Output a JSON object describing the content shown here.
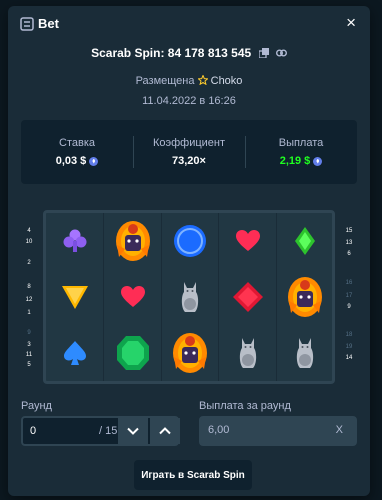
{
  "modal": {
    "title": "Bet",
    "close_label": "×"
  },
  "bet": {
    "title": "Scarab Spin: 84 178 813 545",
    "placed_prefix": "Размещена",
    "user": "Choko",
    "date": "11.04.2022 в 16:26"
  },
  "stats": {
    "wager_label": "Ставка",
    "wager_value": "0,03 $",
    "multiplier_label": "Коэффициент",
    "multiplier_value": "73,20×",
    "payout_label": "Выплата",
    "payout_value": "2,19 $"
  },
  "paylines": {
    "left": [
      "4",
      "10",
      "2",
      "8",
      "12",
      "1",
      "9",
      "3",
      "11",
      "5"
    ],
    "right": [
      "15",
      "13",
      "6",
      "16",
      "17",
      "9",
      "18",
      "19",
      "14"
    ]
  },
  "reels": [
    [
      "club",
      "triangle",
      "spade"
    ],
    [
      "scarab",
      "heart",
      "emerald"
    ],
    [
      "blue-circle",
      "cat",
      "scarab"
    ],
    [
      "heart",
      "red-diamond",
      "cat"
    ],
    [
      "green-diamond",
      "scarab",
      "cat"
    ]
  ],
  "form": {
    "round_label": "Раунд",
    "round_value": "0",
    "round_total": "/ 15",
    "payout_per_round_label": "Выплата за раунд",
    "payout_per_round_value": "6,00",
    "payout_clear": "X",
    "play_button": "Играть в Scarab Spin"
  },
  "colors": {
    "modal_bg": "#1a2c38",
    "panel_bg": "#0f212e",
    "border": "#2f4553",
    "payout_green": "#1fff20"
  }
}
